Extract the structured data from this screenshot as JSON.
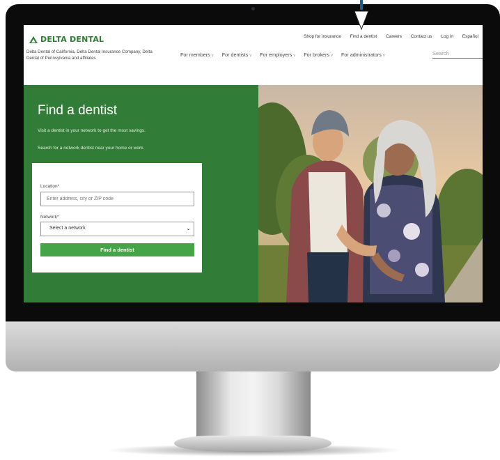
{
  "brand": {
    "logo_text": "DELTA DENTAL",
    "tagline": "Delta Dental of California, Delta Dental Insurance Company, Delta Dental of Pennsylvania and affiliates",
    "color": "#2f7d33"
  },
  "utility_nav": {
    "items": [
      "Shop for insurance",
      "Find a dentist",
      "Careers",
      "Contact us",
      "Log in",
      "Español"
    ]
  },
  "main_nav": {
    "items": [
      "For members",
      "For dentists",
      "For employers",
      "For brokers",
      "For administrators"
    ],
    "chevron": "v"
  },
  "search": {
    "placeholder": "Search"
  },
  "hero": {
    "title": "Find a dentist",
    "subtitle_1": "Visit a dentist in your network to get the most savings.",
    "subtitle_2": "Search for a network dentist near your home or work.",
    "background_color": "#317c36"
  },
  "form": {
    "location_label": "Location*",
    "location_placeholder": "Enter address, city or ZIP code",
    "network_label": "Network*",
    "network_selected": "Select a network",
    "submit_label": "Find a dentist",
    "button_color": "#45a348"
  },
  "photo": {
    "alt": "Two women walking together outdoors"
  },
  "annotation": {
    "arrow_color": "#1a5f8a",
    "points_to": "Find a dentist"
  }
}
